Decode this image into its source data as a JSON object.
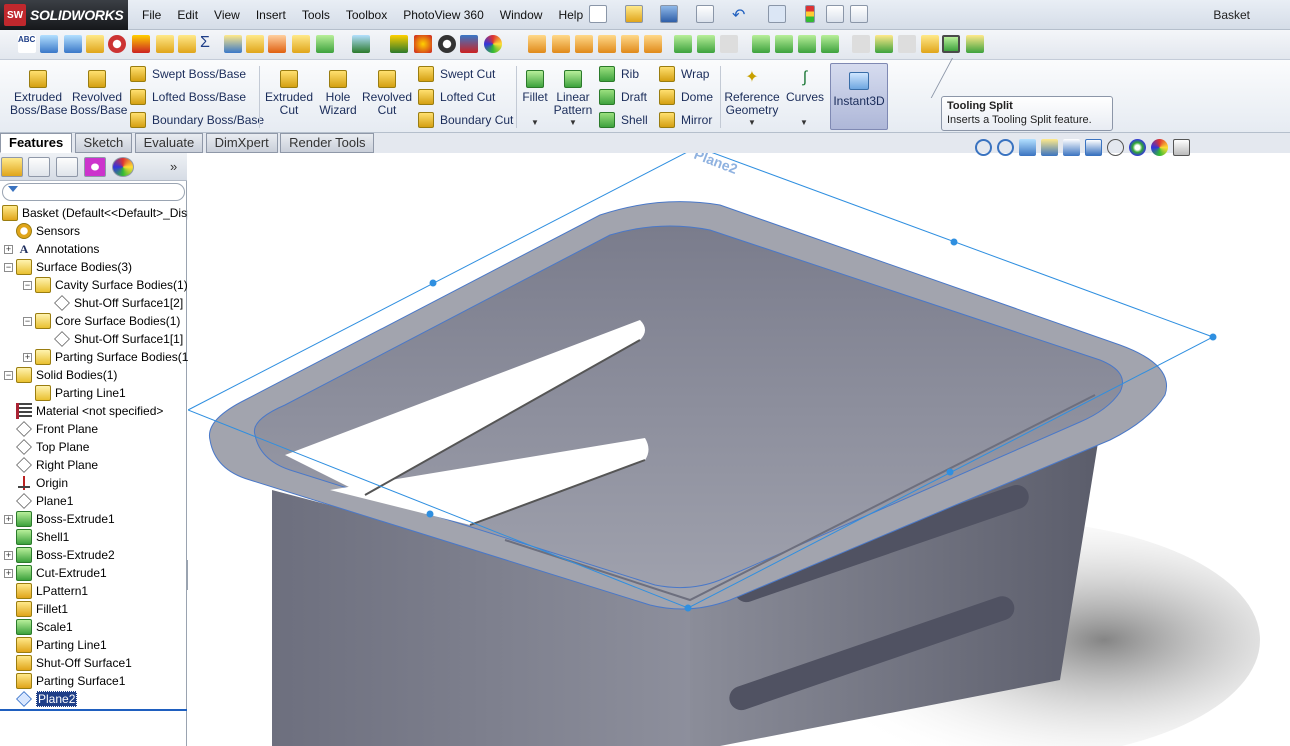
{
  "app": {
    "logo_badge": "SW",
    "logo_text": "SOLIDWORKS",
    "document_title": "Basket"
  },
  "menu": [
    "File",
    "Edit",
    "View",
    "Insert",
    "Tools",
    "Toolbox",
    "PhotoView 360",
    "Window",
    "Help"
  ],
  "command_manager": {
    "extruded_boss": "Extruded Boss/Base",
    "revolved_boss": "Revolved Boss/Base",
    "swept_boss": "Swept Boss/Base",
    "lofted_boss": "Lofted Boss/Base",
    "boundary_boss": "Boundary Boss/Base",
    "extruded_cut": "Extruded Cut",
    "hole_wizard": "Hole Wizard",
    "revolved_cut": "Revolved Cut",
    "swept_cut": "Swept Cut",
    "lofted_cut": "Lofted Cut",
    "boundary_cut": "Boundary Cut",
    "fillet": "Fillet",
    "linear_pattern": "Linear Pattern",
    "rib": "Rib",
    "draft": "Draft",
    "shell": "Shell",
    "wrap": "Wrap",
    "dome": "Dome",
    "mirror": "Mirror",
    "reference_geometry": "Reference Geometry",
    "curves": "Curves",
    "instant3d": "Instant3D"
  },
  "tooltip": {
    "title": "Tooling Split",
    "description": "Inserts a Tooling Split feature."
  },
  "tabs": [
    "Features",
    "Sketch",
    "Evaluate",
    "DimXpert",
    "Render Tools"
  ],
  "tree": {
    "root": "Basket  (Default<<Default>_Displ",
    "items": [
      {
        "label": "Sensors",
        "icon": "sensor-icon"
      },
      {
        "label": "Annotations",
        "icon": "annotations-icon"
      },
      {
        "label": "Surface Bodies(3)",
        "icon": "folder-icon"
      },
      {
        "label": "Cavity Surface Bodies(1)",
        "icon": "folder-icon"
      },
      {
        "label": "Shut-Off Surface1[2]",
        "icon": "surface-icon"
      },
      {
        "label": "Core Surface Bodies(1)",
        "icon": "folder-icon"
      },
      {
        "label": "Shut-Off Surface1[1]",
        "icon": "surface-icon"
      },
      {
        "label": "Parting Surface Bodies(1)",
        "icon": "folder-icon"
      },
      {
        "label": "Solid Bodies(1)",
        "icon": "folder-icon"
      },
      {
        "label": "Parting Line1",
        "icon": "solid-body-icon"
      },
      {
        "label": "Material <not specified>",
        "icon": "material-icon"
      },
      {
        "label": "Front Plane",
        "icon": "plane-icon"
      },
      {
        "label": "Top Plane",
        "icon": "plane-icon"
      },
      {
        "label": "Right Plane",
        "icon": "plane-icon"
      },
      {
        "label": "Origin",
        "icon": "origin-icon"
      },
      {
        "label": "Plane1",
        "icon": "plane-icon"
      },
      {
        "label": "Boss-Extrude1",
        "icon": "extrude-icon"
      },
      {
        "label": "Shell1",
        "icon": "shell-icon"
      },
      {
        "label": "Boss-Extrude2",
        "icon": "extrude-icon"
      },
      {
        "label": "Cut-Extrude1",
        "icon": "cut-icon"
      },
      {
        "label": "LPattern1",
        "icon": "pattern-icon"
      },
      {
        "label": "Fillet1",
        "icon": "fillet-icon"
      },
      {
        "label": "Scale1",
        "icon": "scale-icon"
      },
      {
        "label": "Parting Line1",
        "icon": "parting-line-icon"
      },
      {
        "label": "Shut-Off Surface1",
        "icon": "shutoff-icon"
      },
      {
        "label": "Parting Surface1",
        "icon": "parting-surface-icon"
      },
      {
        "label": "Plane2",
        "icon": "plane-icon",
        "selected": true
      }
    ]
  },
  "viewport": {
    "plane_label": "Plane2"
  },
  "colors": {
    "accent": "#2f8fe0",
    "selection": "#1f3f88",
    "part": "#7f8292"
  }
}
